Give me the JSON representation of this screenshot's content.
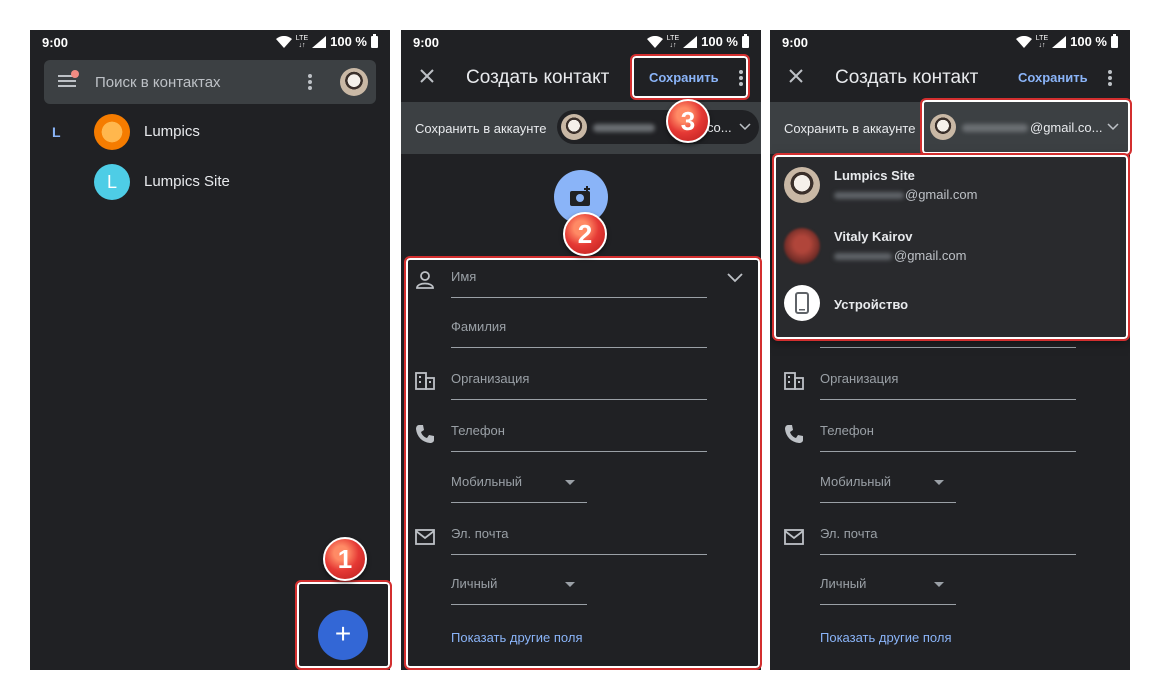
{
  "status": {
    "time": "9:00",
    "network": "LTE",
    "battery": "100 %"
  },
  "contacts_screen": {
    "search_placeholder": "Поиск в контактах",
    "section_letter": "L",
    "contacts": [
      {
        "name": "Lumpics"
      },
      {
        "name": "Lumpics Site",
        "initial": "L"
      }
    ],
    "fab_label": "+"
  },
  "create_screen": {
    "title": "Создать контакт",
    "save_label": "Сохранить",
    "save_to_label": "Сохранить в аккаунте",
    "account_chip_suffix": "co...",
    "account_chip_suffix_full": "@gmail.co...",
    "fields": {
      "first_name": "Имя",
      "last_name": "Фамилия",
      "organization": "Организация",
      "phone": "Телефон",
      "phone_type": "Мобильный",
      "email": "Эл. почта",
      "email_type": "Личный"
    },
    "more_fields": "Показать другие поля"
  },
  "account_dropdown": {
    "items": [
      {
        "name": "Lumpics Site",
        "email_suffix": "@gmail.com"
      },
      {
        "name": "Vitaly Kairov",
        "email_suffix": "@gmail.com"
      },
      {
        "name": "Устройство"
      }
    ]
  },
  "steps": [
    "1",
    "2",
    "3"
  ],
  "colors": {
    "background": "#202124",
    "accent": "#8ab4f8",
    "fab": "#3367d6",
    "highlight": "#d32f2f"
  }
}
